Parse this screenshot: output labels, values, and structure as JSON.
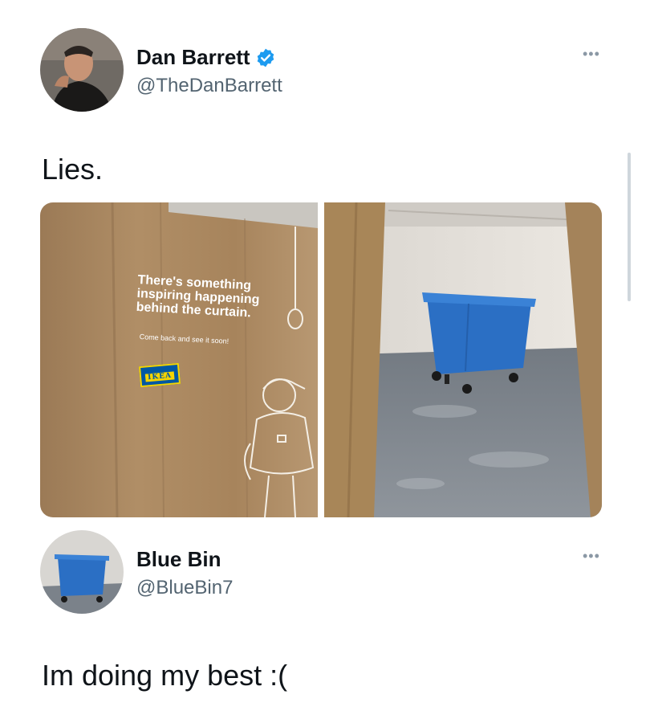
{
  "tweet": {
    "author_name": "Dan Barrett",
    "author_handle": "@TheDanBarrett",
    "verified_icon": "verified-badge-icon",
    "text": "Lies.",
    "media": {
      "curtain_headline": [
        "There's something",
        "inspiring happening",
        "behind the curtain."
      ],
      "curtain_subtext": "Come back and see it soon!",
      "logo_text": "IKEA"
    }
  },
  "reply": {
    "author_name": "Blue Bin",
    "author_handle": "@BlueBin7",
    "text": "Im doing my best :("
  },
  "more_icon": "more-options-icon",
  "colors": {
    "verified": "#1d9bf0",
    "handle": "#536471",
    "bin_blue": "#2b6fc4"
  }
}
